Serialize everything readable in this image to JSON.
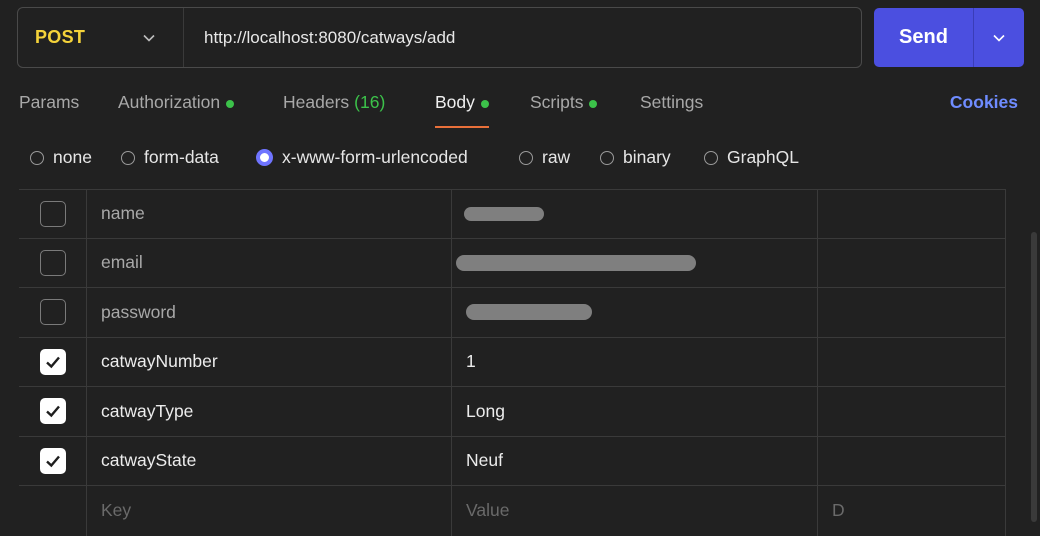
{
  "request": {
    "method": "POST",
    "url": "http://localhost:8080/catways/add",
    "send_label": "Send"
  },
  "tabs": [
    {
      "label": "Params"
    },
    {
      "label": "Authorization"
    },
    {
      "label": "Headers",
      "count": "(16)"
    },
    {
      "label": "Body"
    },
    {
      "label": "Scripts"
    },
    {
      "label": "Settings"
    }
  ],
  "cookies_label": "Cookies",
  "body_types": [
    "none",
    "form-data",
    "x-www-form-urlencoded",
    "raw",
    "binary",
    "GraphQL"
  ],
  "selected_body_type": "x-www-form-urlencoded",
  "params": [
    {
      "key": "name",
      "value": "",
      "checked": false
    },
    {
      "key": "email",
      "value": "",
      "checked": false
    },
    {
      "key": "password",
      "value": "",
      "checked": false
    },
    {
      "key": "catwayNumber",
      "value": "1",
      "checked": true
    },
    {
      "key": "catwayType",
      "value": "Long",
      "checked": true
    },
    {
      "key": "catwayState",
      "value": "Neuf",
      "checked": true
    }
  ],
  "placeholders": {
    "key": "Key",
    "value": "Value",
    "description": "D"
  },
  "colors": {
    "method": "#f5d33a",
    "send": "#4b4fe0",
    "active_tab_underline": "#e9703a",
    "status_dot": "#3cc24a",
    "link": "#6f8cff"
  }
}
